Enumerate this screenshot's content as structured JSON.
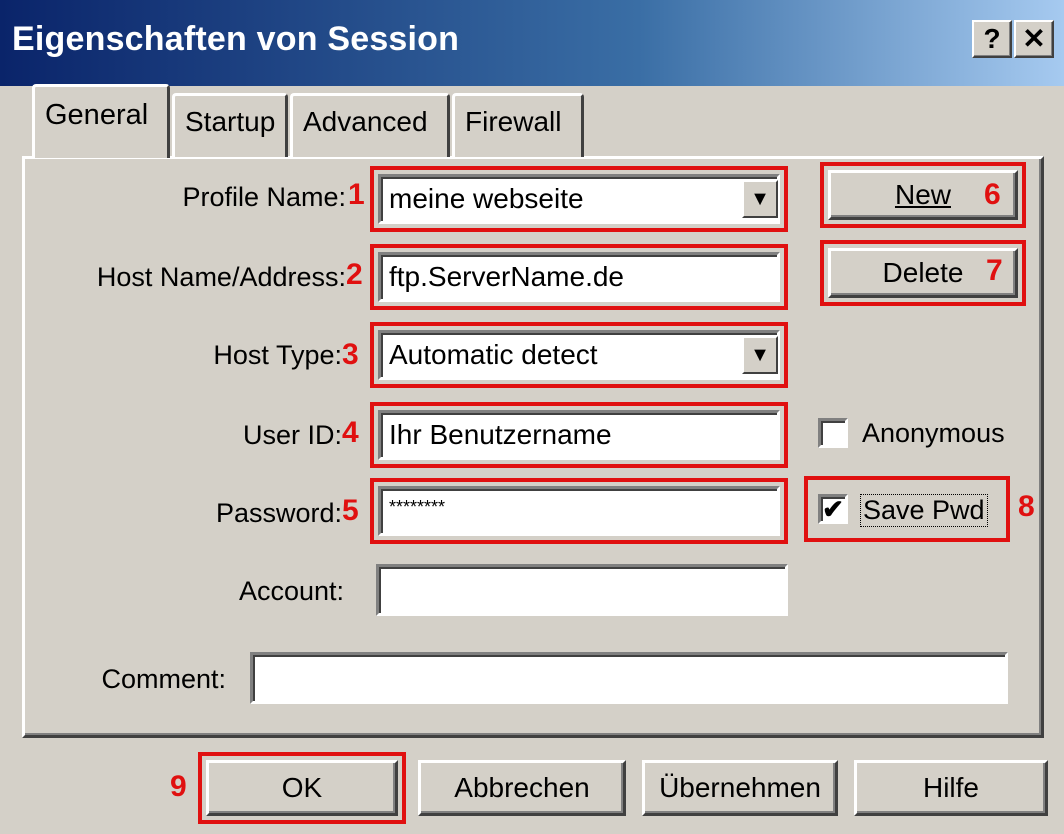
{
  "window": {
    "title": "Eigenschaften von Session",
    "help_glyph": "?",
    "close_glyph": "✕"
  },
  "tabs": [
    {
      "label": "General",
      "active": true
    },
    {
      "label": "Startup",
      "active": false
    },
    {
      "label": "Advanced",
      "active": false
    },
    {
      "label": "Firewall",
      "active": false
    }
  ],
  "form": {
    "profile_name_label": "Profile Name:",
    "profile_name_value": "meine webseite",
    "host_label": "Host Name/Address:",
    "host_value": "ftp.ServerName.de",
    "host_type_label": "Host Type:",
    "host_type_value": "Automatic detect",
    "user_label": "User ID:",
    "user_value": "Ihr Benutzername",
    "password_label": "Password:",
    "password_value": "********",
    "account_label": "Account:",
    "account_value": "",
    "comment_label": "Comment:",
    "comment_value": ""
  },
  "side": {
    "new_label": "New",
    "delete_label": "Delete",
    "anonymous_label": "Anonymous",
    "anonymous_checked": false,
    "savepwd_label": "Save Pwd",
    "savepwd_checked": true,
    "check_glyph": "✔"
  },
  "buttons": {
    "ok": "OK",
    "cancel": "Abbrechen",
    "apply": "Übernehmen",
    "help": "Hilfe"
  },
  "annotations": {
    "n1": "1",
    "n2": "2",
    "n3": "3",
    "n4": "4",
    "n5": "5",
    "n6": "6",
    "n7": "7",
    "n8": "8",
    "n9": "9"
  },
  "colors": {
    "annotation_red": "#e01010",
    "titlebar_start": "#0a246a",
    "titlebar_end": "#a6caf0",
    "face": "#d4d0c8"
  },
  "icons": {
    "combo_arrow": "▼"
  }
}
